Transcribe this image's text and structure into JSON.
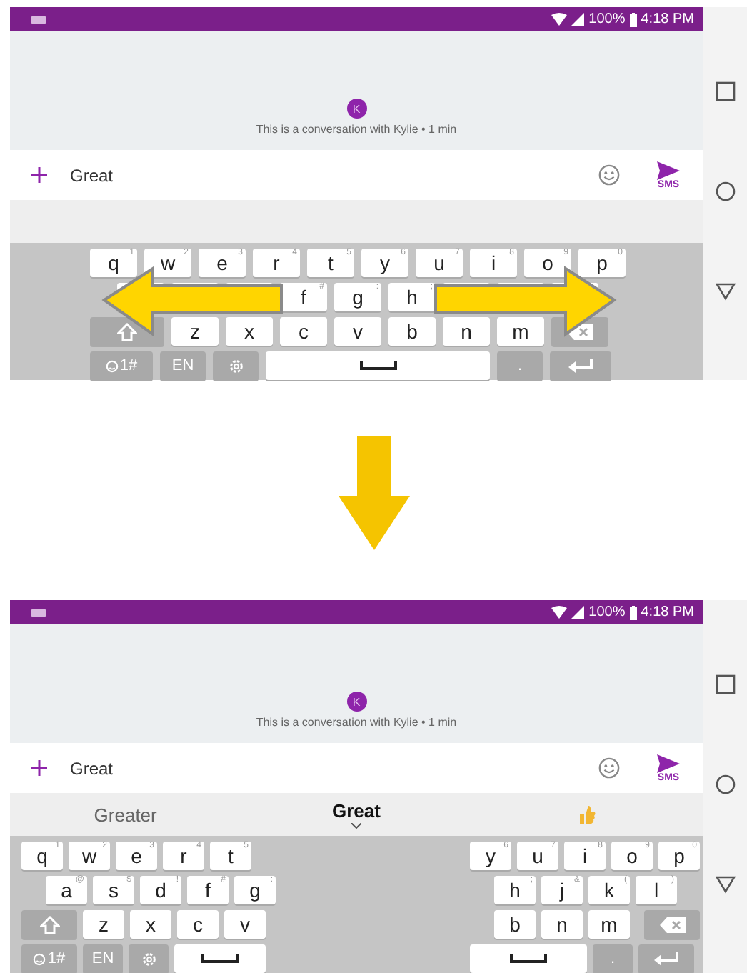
{
  "screens": [
    {
      "status_bar": {
        "battery": "100%",
        "time": "4:18 PM"
      },
      "conversation": {
        "avatar": "K",
        "info": "This is a conversation with Kylie • 1 min"
      },
      "composer": {
        "value": "Great",
        "send_label": "SMS"
      },
      "gesture_arrows": true,
      "keyboard": {
        "halves": [
          [
            [
              {
                "kind": "letter",
                "label": "q",
                "hint": "1"
              },
              {
                "kind": "letter",
                "label": "w",
                "hint": "2"
              },
              {
                "kind": "letter",
                "label": "e",
                "hint": "3"
              },
              {
                "kind": "letter",
                "label": "r",
                "hint": "4"
              },
              {
                "kind": "letter",
                "label": "t",
                "hint": "5"
              },
              {
                "kind": "letter",
                "label": "y",
                "hint": "6"
              },
              {
                "kind": "letter",
                "label": "u",
                "hint": "7"
              },
              {
                "kind": "letter",
                "label": "i",
                "hint": "8"
              },
              {
                "kind": "letter",
                "label": "o",
                "hint": "9"
              },
              {
                "kind": "letter",
                "label": "p",
                "hint": "0"
              }
            ],
            [
              {
                "kind": "letter"
              },
              {
                "kind": "letter"
              },
              {
                "kind": "letter"
              },
              {
                "kind": "letter",
                "label": "f",
                "hint": "#"
              },
              {
                "kind": "letter",
                "label": "g",
                "hint": ":"
              },
              {
                "kind": "letter",
                "label": "h",
                "hint": ";"
              },
              {
                "kind": "letter"
              },
              {
                "kind": "letter"
              },
              {
                "kind": "letter"
              }
            ],
            [
              {
                "kind": "shift"
              },
              {
                "kind": "letter",
                "label": "z"
              },
              {
                "kind": "letter",
                "label": "x"
              },
              {
                "kind": "letter",
                "label": "c"
              },
              {
                "kind": "letter",
                "label": "v"
              },
              {
                "kind": "letter",
                "label": "b"
              },
              {
                "kind": "letter",
                "label": "n"
              },
              {
                "kind": "letter",
                "label": "m"
              },
              {
                "kind": "backspace"
              }
            ],
            [
              {
                "kind": "symbols",
                "label": "1#"
              },
              {
                "kind": "language",
                "label": "EN"
              },
              {
                "kind": "settings"
              },
              {
                "kind": "space"
              },
              {
                "kind": "period",
                "label": "."
              },
              {
                "kind": "enter"
              }
            ]
          ]
        ]
      }
    },
    {
      "status_bar": {
        "battery": "100%",
        "time": "4:18 PM"
      },
      "conversation": {
        "avatar": "K",
        "info": "This is a conversation with Kylie • 1 min"
      },
      "composer": {
        "value": "Great",
        "send_label": "SMS"
      },
      "suggestions": [
        {
          "kind": "word",
          "label": "Greater",
          "selected": false
        },
        {
          "kind": "word",
          "label": "Great",
          "selected": true
        },
        {
          "kind": "emoji",
          "selected": false
        }
      ],
      "keyboard": {
        "halves": [
          [
            [
              {
                "kind": "letter",
                "label": "q",
                "hint": "1"
              },
              {
                "kind": "letter",
                "label": "w",
                "hint": "2"
              },
              {
                "kind": "letter",
                "label": "e",
                "hint": "3"
              },
              {
                "kind": "letter",
                "label": "r",
                "hint": "4"
              },
              {
                "kind": "letter",
                "label": "t",
                "hint": "5"
              }
            ],
            [
              {
                "kind": "letter",
                "label": "a",
                "hint": "@"
              },
              {
                "kind": "letter",
                "label": "s",
                "hint": "$"
              },
              {
                "kind": "letter",
                "label": "d",
                "hint": "!"
              },
              {
                "kind": "letter",
                "label": "f",
                "hint": "#"
              },
              {
                "kind": "letter",
                "label": "g",
                "hint": ":"
              }
            ],
            [
              {
                "kind": "shift"
              },
              {
                "kind": "letter",
                "label": "z"
              },
              {
                "kind": "letter",
                "label": "x"
              },
              {
                "kind": "letter",
                "label": "c"
              },
              {
                "kind": "letter",
                "label": "v"
              }
            ],
            [
              {
                "kind": "symbols",
                "label": "1#"
              },
              {
                "kind": "language",
                "label": "EN"
              },
              {
                "kind": "settings"
              },
              {
                "kind": "space"
              }
            ]
          ],
          [
            [
              {
                "kind": "letter",
                "label": "y",
                "hint": "6"
              },
              {
                "kind": "letter",
                "label": "u",
                "hint": "7"
              },
              {
                "kind": "letter",
                "label": "i",
                "hint": "8"
              },
              {
                "kind": "letter",
                "label": "o",
                "hint": "9"
              },
              {
                "kind": "letter",
                "label": "p",
                "hint": "0"
              }
            ],
            [
              {
                "kind": "letter",
                "label": "h",
                "hint": ";"
              },
              {
                "kind": "letter",
                "label": "j",
                "hint": "&"
              },
              {
                "kind": "letter",
                "label": "k",
                "hint": "("
              },
              {
                "kind": "letter",
                "label": "l",
                "hint": ")"
              }
            ],
            [
              {
                "kind": "letter",
                "label": "b"
              },
              {
                "kind": "letter",
                "label": "n"
              },
              {
                "kind": "letter",
                "label": "m"
              },
              {
                "kind": "backspace"
              }
            ],
            [
              {
                "kind": "space"
              },
              {
                "kind": "period",
                "label": "."
              },
              {
                "kind": "enter"
              }
            ]
          ]
        ]
      }
    }
  ]
}
